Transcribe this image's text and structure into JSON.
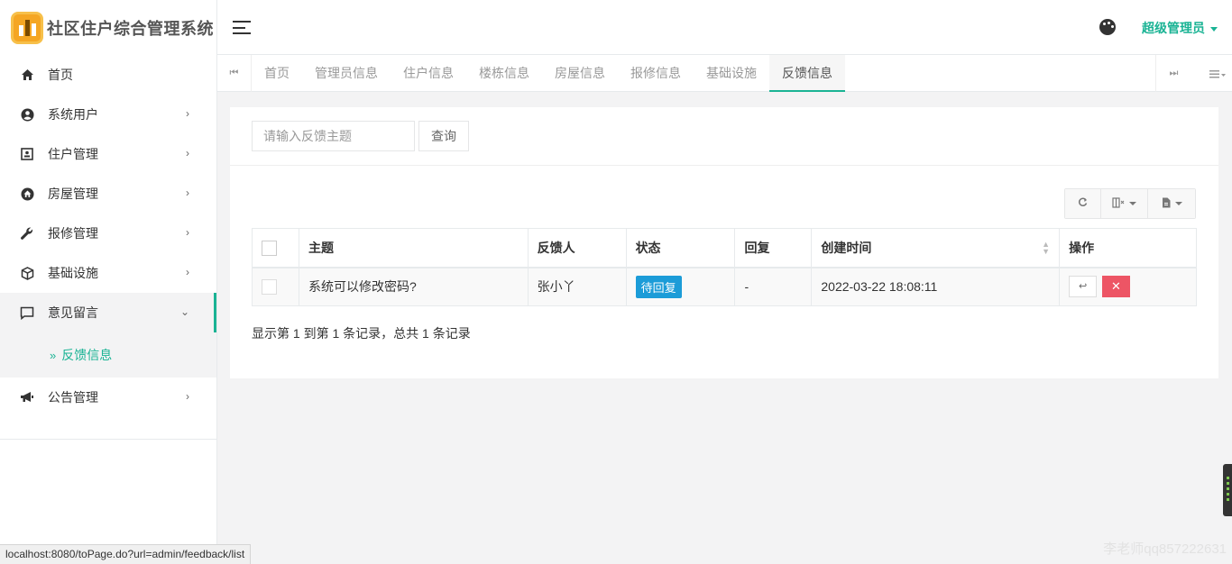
{
  "app": {
    "title": "社区住户综合管理系统"
  },
  "sidebar": {
    "items": [
      {
        "label": "首页",
        "icon": "home-icon"
      },
      {
        "label": "系统用户",
        "icon": "user-circle-icon"
      },
      {
        "label": "住户管理",
        "icon": "id-card-icon"
      },
      {
        "label": "房屋管理",
        "icon": "house-icon"
      },
      {
        "label": "报修管理",
        "icon": "wrench-icon"
      },
      {
        "label": "基础设施",
        "icon": "cube-icon"
      },
      {
        "label": "意见留言",
        "icon": "comment-icon"
      },
      {
        "label": "公告管理",
        "icon": "megaphone-icon"
      }
    ],
    "sub_items": [
      {
        "label": "反馈信息"
      }
    ]
  },
  "header": {
    "user": "超级管理员"
  },
  "tabs": [
    {
      "label": "首页"
    },
    {
      "label": "管理员信息"
    },
    {
      "label": "住户信息"
    },
    {
      "label": "楼栋信息"
    },
    {
      "label": "房屋信息"
    },
    {
      "label": "报修信息"
    },
    {
      "label": "基础设施"
    },
    {
      "label": "反馈信息"
    }
  ],
  "search": {
    "placeholder": "请输入反馈主题",
    "button": "查询"
  },
  "table": {
    "columns": [
      "主题",
      "反馈人",
      "状态",
      "回复",
      "创建时间",
      "操作"
    ],
    "rows": [
      {
        "subject": "系统可以修改密码?",
        "author": "张小丫",
        "status": "待回复",
        "reply": "-",
        "created": "2022-03-22 18:08:11"
      }
    ]
  },
  "pager": {
    "info": "显示第 1 到第 1 条记录，总共 1 条记录"
  },
  "statusbar": {
    "url": "localhost:8080/toPage.do?url=admin/feedback/list"
  },
  "watermark": {
    "text": "李老师qq857222631"
  },
  "colors": {
    "accent": "#1ab394",
    "status_badge": "#1c9cd8",
    "danger": "#ed5565"
  }
}
